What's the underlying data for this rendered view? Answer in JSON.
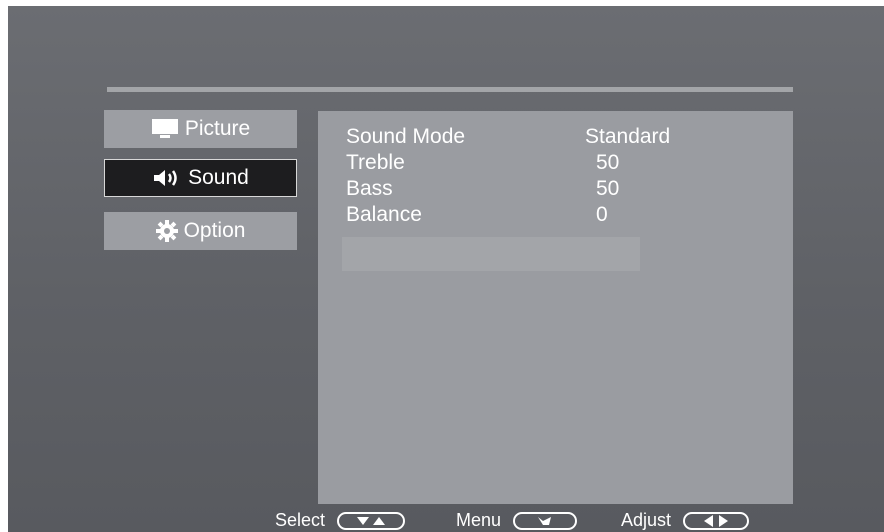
{
  "menu": {
    "items": [
      {
        "label": "Picture",
        "icon": "monitor-icon"
      },
      {
        "label": "Sound",
        "icon": "speaker-icon"
      },
      {
        "label": "Option",
        "icon": "gear-icon"
      }
    ],
    "active_index": 1
  },
  "sound": {
    "rows": [
      {
        "label": "Sound Mode",
        "value": "Standard"
      },
      {
        "label": "Treble",
        "value": "50"
      },
      {
        "label": "Bass",
        "value": "50"
      },
      {
        "label": "Balance",
        "value": "0"
      }
    ]
  },
  "footer": {
    "select_label": "Select",
    "menu_label": "Menu",
    "adjust_label": "Adjust"
  },
  "colors": {
    "background": "#5f6166",
    "panel": "#9a9ca1",
    "active_item": "#1d1d1f",
    "text": "#ffffff"
  }
}
